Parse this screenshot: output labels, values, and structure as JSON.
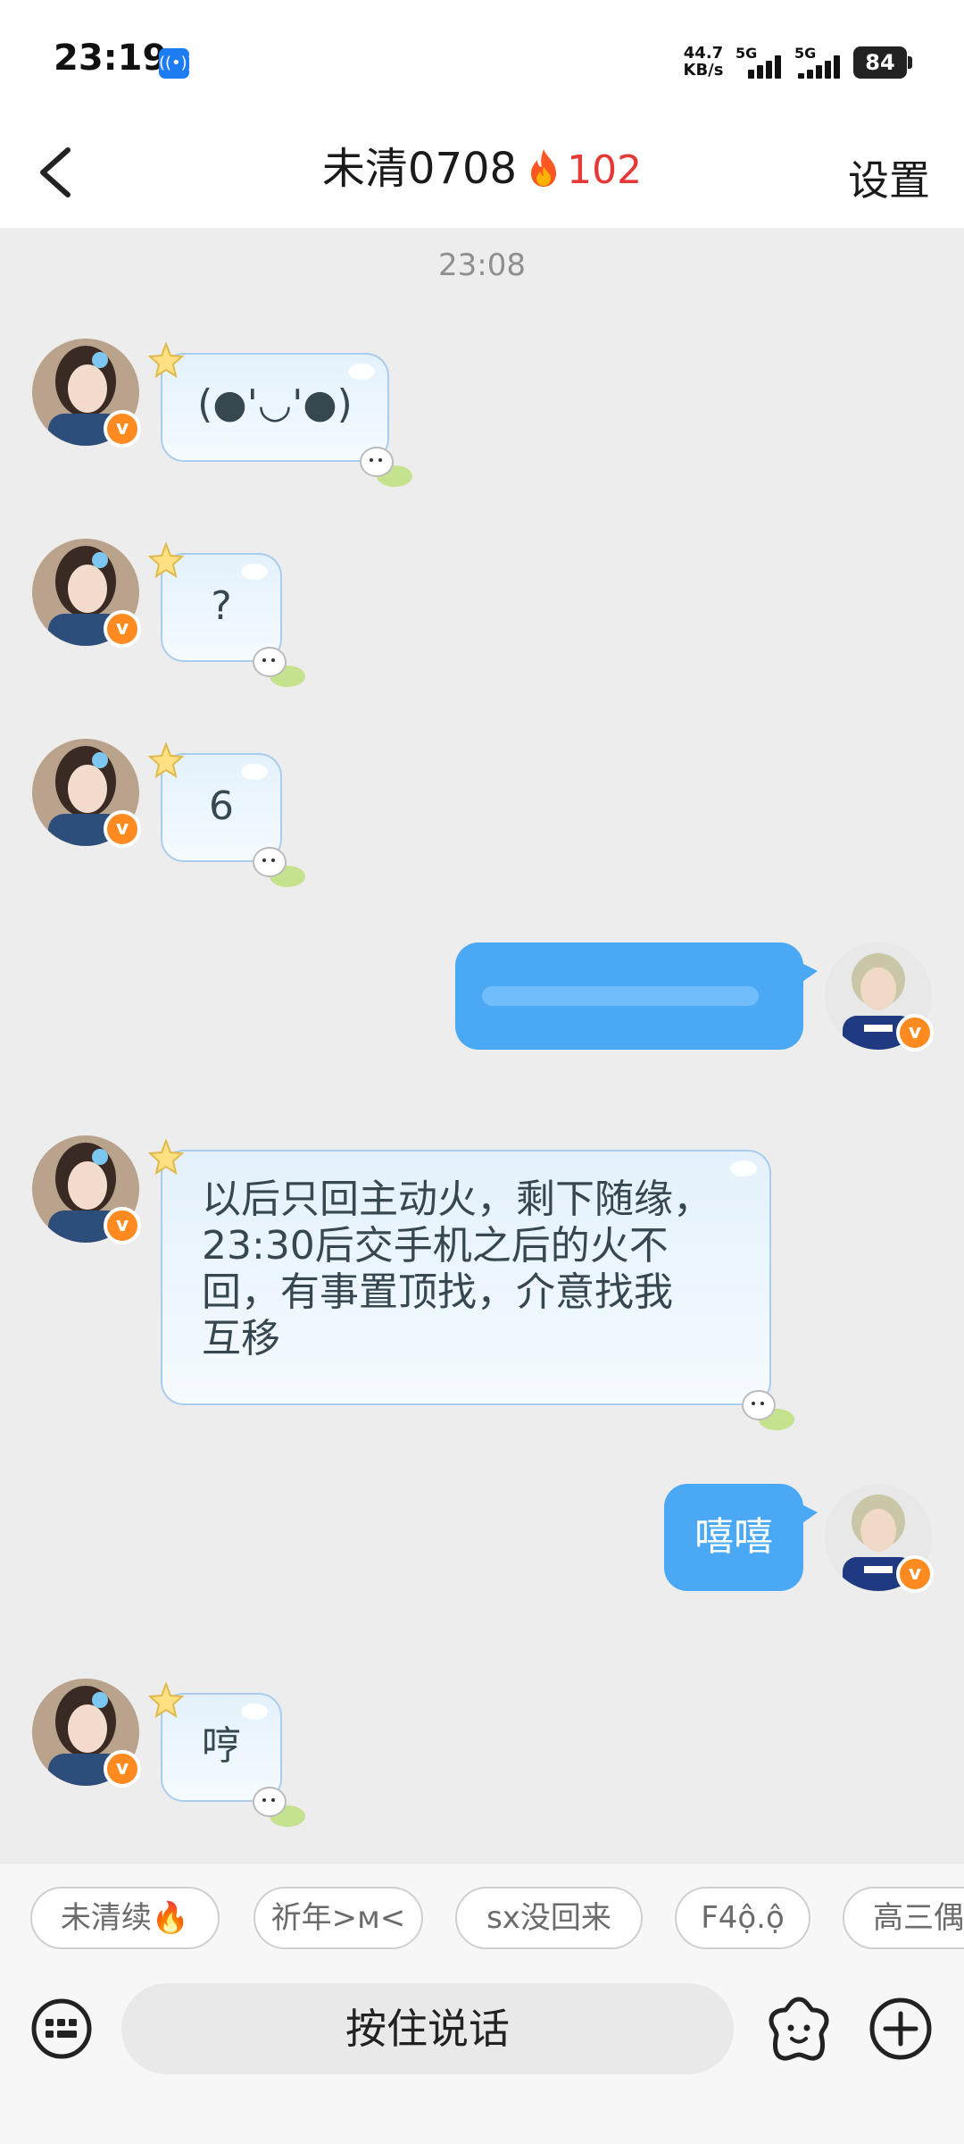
{
  "status_bar": {
    "time": "23:19",
    "net_speed_value": "44.7",
    "net_speed_unit": "KB/s",
    "sim1_label": "5G",
    "sim2_label": "5G",
    "battery": "84"
  },
  "header": {
    "title": "未清0708",
    "streak_count": "102",
    "settings_label": "设置"
  },
  "chat": {
    "time_divider": "23:08",
    "messages": [
      {
        "side": "in",
        "text": "(●'◡'●)"
      },
      {
        "side": "in",
        "text": "?"
      },
      {
        "side": "in",
        "text": "6"
      },
      {
        "side": "out",
        "text": ""
      },
      {
        "side": "in",
        "lines": [
          "以后只回主动火，剩下随缘，",
          "23:30后交手机之后的火不",
          "回，有事置顶找，介意找我",
          "互移"
        ]
      },
      {
        "side": "out",
        "text": "嘻嘻"
      },
      {
        "side": "in",
        "text": "哼"
      }
    ]
  },
  "quick_phrases": [
    "未清续🔥",
    "祈年>ᴍ<",
    "sx没回来",
    "F4ộ.ộ",
    "高三偶"
  ],
  "input_bar": {
    "voice_label": "按住说话"
  },
  "colors": {
    "outgoing_bubble": "#4aa8f5",
    "incoming_bubble_border": "#a9cdee",
    "badge": "#ff8a1f",
    "streak": "#e53935"
  }
}
